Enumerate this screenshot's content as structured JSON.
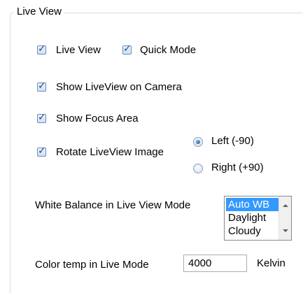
{
  "group": {
    "title": "Live View"
  },
  "checkboxes": {
    "live_view": {
      "label": "Live View",
      "checked": true
    },
    "quick_mode": {
      "label": "Quick Mode",
      "checked": true
    },
    "show_on_camera": {
      "label": "Show LiveView on Camera",
      "checked": true
    },
    "show_focus_area": {
      "label": "Show Focus Area",
      "checked": true
    },
    "rotate_image": {
      "label": "Rotate LiveView Image",
      "checked": true
    }
  },
  "rotation": {
    "left": {
      "label": "Left (-90)",
      "selected": true
    },
    "right": {
      "label": "Right (+90)",
      "selected": false
    }
  },
  "white_balance": {
    "label": "White Balance in Live View Mode",
    "options": [
      "Auto WB",
      "Daylight",
      "Cloudy"
    ],
    "selected": "Auto WB"
  },
  "color_temp": {
    "label": "Color temp in Live Mode",
    "value": "4000",
    "unit": "Kelvin"
  },
  "colors": {
    "selection": "#3399ff",
    "border": "#d5dfe5"
  }
}
